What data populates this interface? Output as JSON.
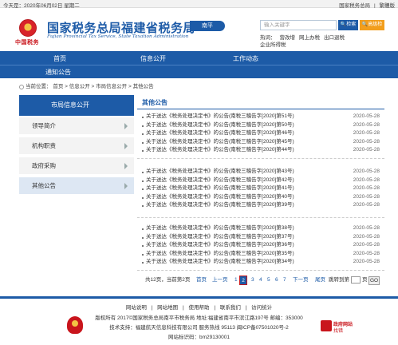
{
  "topbar": {
    "date": "今天是：2020年06月02日 星期二",
    "links": [
      "国家税务总局",
      "|",
      "繁體版"
    ]
  },
  "header": {
    "emblem_text": "中国税务",
    "title": "国家税务总局福建省税务局",
    "subtitle": "Fujian Provincial Tax Service,  State Taxation Administration",
    "city": "南平",
    "search_placeholder": "输入关键字",
    "search_button": "检索",
    "advanced_button": "高级检索",
    "hot_links": [
      "热词：",
      "营改增",
      "网上办税",
      "出口退税",
      "企业所得税"
    ]
  },
  "nav": {
    "items": [
      "首页",
      "信息公开",
      "工作动态",
      "通知公告"
    ]
  },
  "breadcrumb": {
    "items": [
      "当前位置：",
      "首页",
      ">",
      "信息公开",
      ">",
      "市局信息公开",
      ">",
      "其他公告"
    ]
  },
  "sidebar": {
    "title": "市局信息公开",
    "items": [
      {
        "label": "领导简介",
        "active": false
      },
      {
        "label": "机构职责",
        "active": false
      },
      {
        "label": "政府采购",
        "active": false
      },
      {
        "label": "其他公告",
        "active": true
      }
    ]
  },
  "content": {
    "title": "其他公告",
    "groups": [
      [
        {
          "text": "关于送达《税务处理决定书》的公告(南税三稽告字[2020]第51号)",
          "date": "2020-05-28"
        },
        {
          "text": "关于送达《税务处理决定书》的公告(南税三稽告字[2020]第50号)",
          "date": "2020-05-28"
        },
        {
          "text": "关于送达《税务处理决定书》的公告(南税三稽告字[2020]第46号)",
          "date": "2020-05-28"
        },
        {
          "text": "关于送达《税务处理决定书》的公告(南税三稽告字[2020]第45号)",
          "date": "2020-05-28"
        },
        {
          "text": "关于送达《税务处理决定书》的公告(南税三稽告字[2020]第44号)",
          "date": "2020-05-28"
        }
      ],
      [
        {
          "text": "关于送达《税务处理决定书》的公告(南税三稽告字[2020]第43号)",
          "date": "2020-05-28"
        },
        {
          "text": "关于送达《税务处理决定书》的公告(南税三稽告字[2020]第42号)",
          "date": "2020-05-28"
        },
        {
          "text": "关于送达《税务处理决定书》的公告(南税三稽告字[2020]第41号)",
          "date": "2020-05-28"
        },
        {
          "text": "关于送达《税务处理决定书》的公告(南税三稽告字[2020]第40号)",
          "date": "2020-05-28"
        },
        {
          "text": "关于送达《税务处理决定书》的公告(南税三稽告字[2020]第39号)",
          "date": "2020-05-28"
        }
      ],
      [
        {
          "text": "关于送达《税务处理决定书》的公告(南税三稽告字[2020]第38号)",
          "date": "2020-05-28"
        },
        {
          "text": "关于送达《税务处理决定书》的公告(南税三稽告字[2020]第37号)",
          "date": "2020-05-28"
        },
        {
          "text": "关于送达《税务处理决定书》的公告(南税三稽告字[2020]第36号)",
          "date": "2020-05-28"
        },
        {
          "text": "关于送达《税务处理决定书》的公告(南税三稽告字[2020]第35号)",
          "date": "2020-05-28"
        },
        {
          "text": "关于送达《税务处理决定书》的公告(南税三稽告字[2020]第34号)",
          "date": "2020-05-28"
        }
      ]
    ]
  },
  "pager": {
    "summary": "共12页，当前第2页",
    "first": "首页",
    "prev": "上一页",
    "pages": [
      "1",
      "2",
      "3",
      "4",
      "5",
      "6",
      "7"
    ],
    "current": "2",
    "next": "下一页",
    "last": "尾页",
    "jump_label": "跳转到第",
    "page_unit": "页",
    "go": "GO"
  },
  "footer": {
    "links": [
      "网站说明",
      "|",
      "网站地图",
      "|",
      "使用帮助",
      "|",
      "联系我们",
      "|",
      "访问统计"
    ],
    "copyright": "版权所有 2017©国家税务总局南平市税务局 地址:福建省南平市滨江路197号 邮编：353000",
    "support": "技术支持：福建航天信息科技有限公司 服务热线 95113 闽ICP备07501020号-2",
    "site_id": "网站标识码：bm29130001",
    "error_badge_line1": "政府网站",
    "error_badge_line2": "找错"
  },
  "colors": {
    "brand_blue": "#1d5ba7",
    "accent_orange": "#f29e1d",
    "party_red": "#c9151c"
  }
}
